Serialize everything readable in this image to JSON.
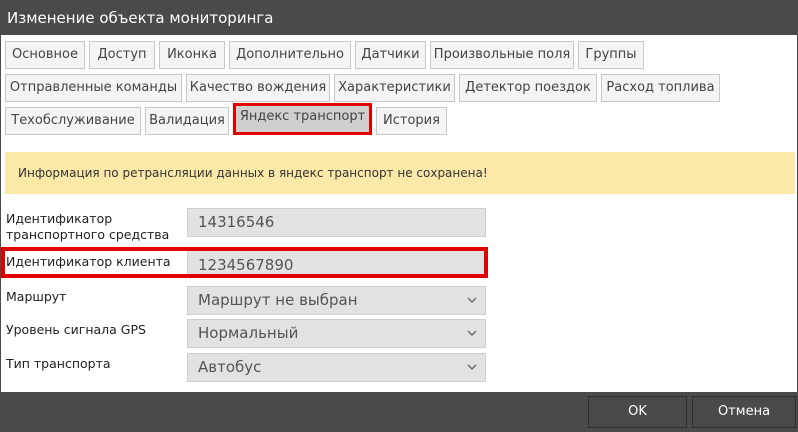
{
  "window": {
    "title": "Изменение объекта мониторинга"
  },
  "tabs": [
    {
      "label": "Основное"
    },
    {
      "label": "Доступ"
    },
    {
      "label": "Иконка"
    },
    {
      "label": "Дополнительно"
    },
    {
      "label": "Датчики"
    },
    {
      "label": "Произвольные поля"
    },
    {
      "label": "Группы"
    },
    {
      "label": "Отправленные команды"
    },
    {
      "label": "Качество вождения"
    },
    {
      "label": "Характеристики"
    },
    {
      "label": "Детектор поездок"
    },
    {
      "label": "Расход топлива"
    },
    {
      "label": "Техобслуживание"
    },
    {
      "label": "Валидация"
    },
    {
      "label": "Яндекс транспорт",
      "active": true
    },
    {
      "label": "История"
    }
  ],
  "alert": {
    "text": "Информация по ретрансляции данных в яндекс транспорт не сохранена!"
  },
  "form": {
    "vehicle_id": {
      "label_line1": "Идентификатор",
      "label_line2": "транспортного средства",
      "value": "14316546"
    },
    "client_id": {
      "label": "Идентификатор клиента",
      "value": "1234567890"
    },
    "route": {
      "label": "Маршрут",
      "value": "Маршрут не выбран"
    },
    "gps_level": {
      "label": "Уровень сигнала GPS",
      "value": "Нормальный"
    },
    "transport_type": {
      "label": "Тип транспорта",
      "value": "Автобус"
    }
  },
  "footer": {
    "ok_label": "OK",
    "cancel_label": "Отмена"
  },
  "colors": {
    "titlebar": "#4a4a4a",
    "alert_bg": "#fce9a8",
    "highlight": "#e00000",
    "field_bg": "#e2e2e2"
  }
}
